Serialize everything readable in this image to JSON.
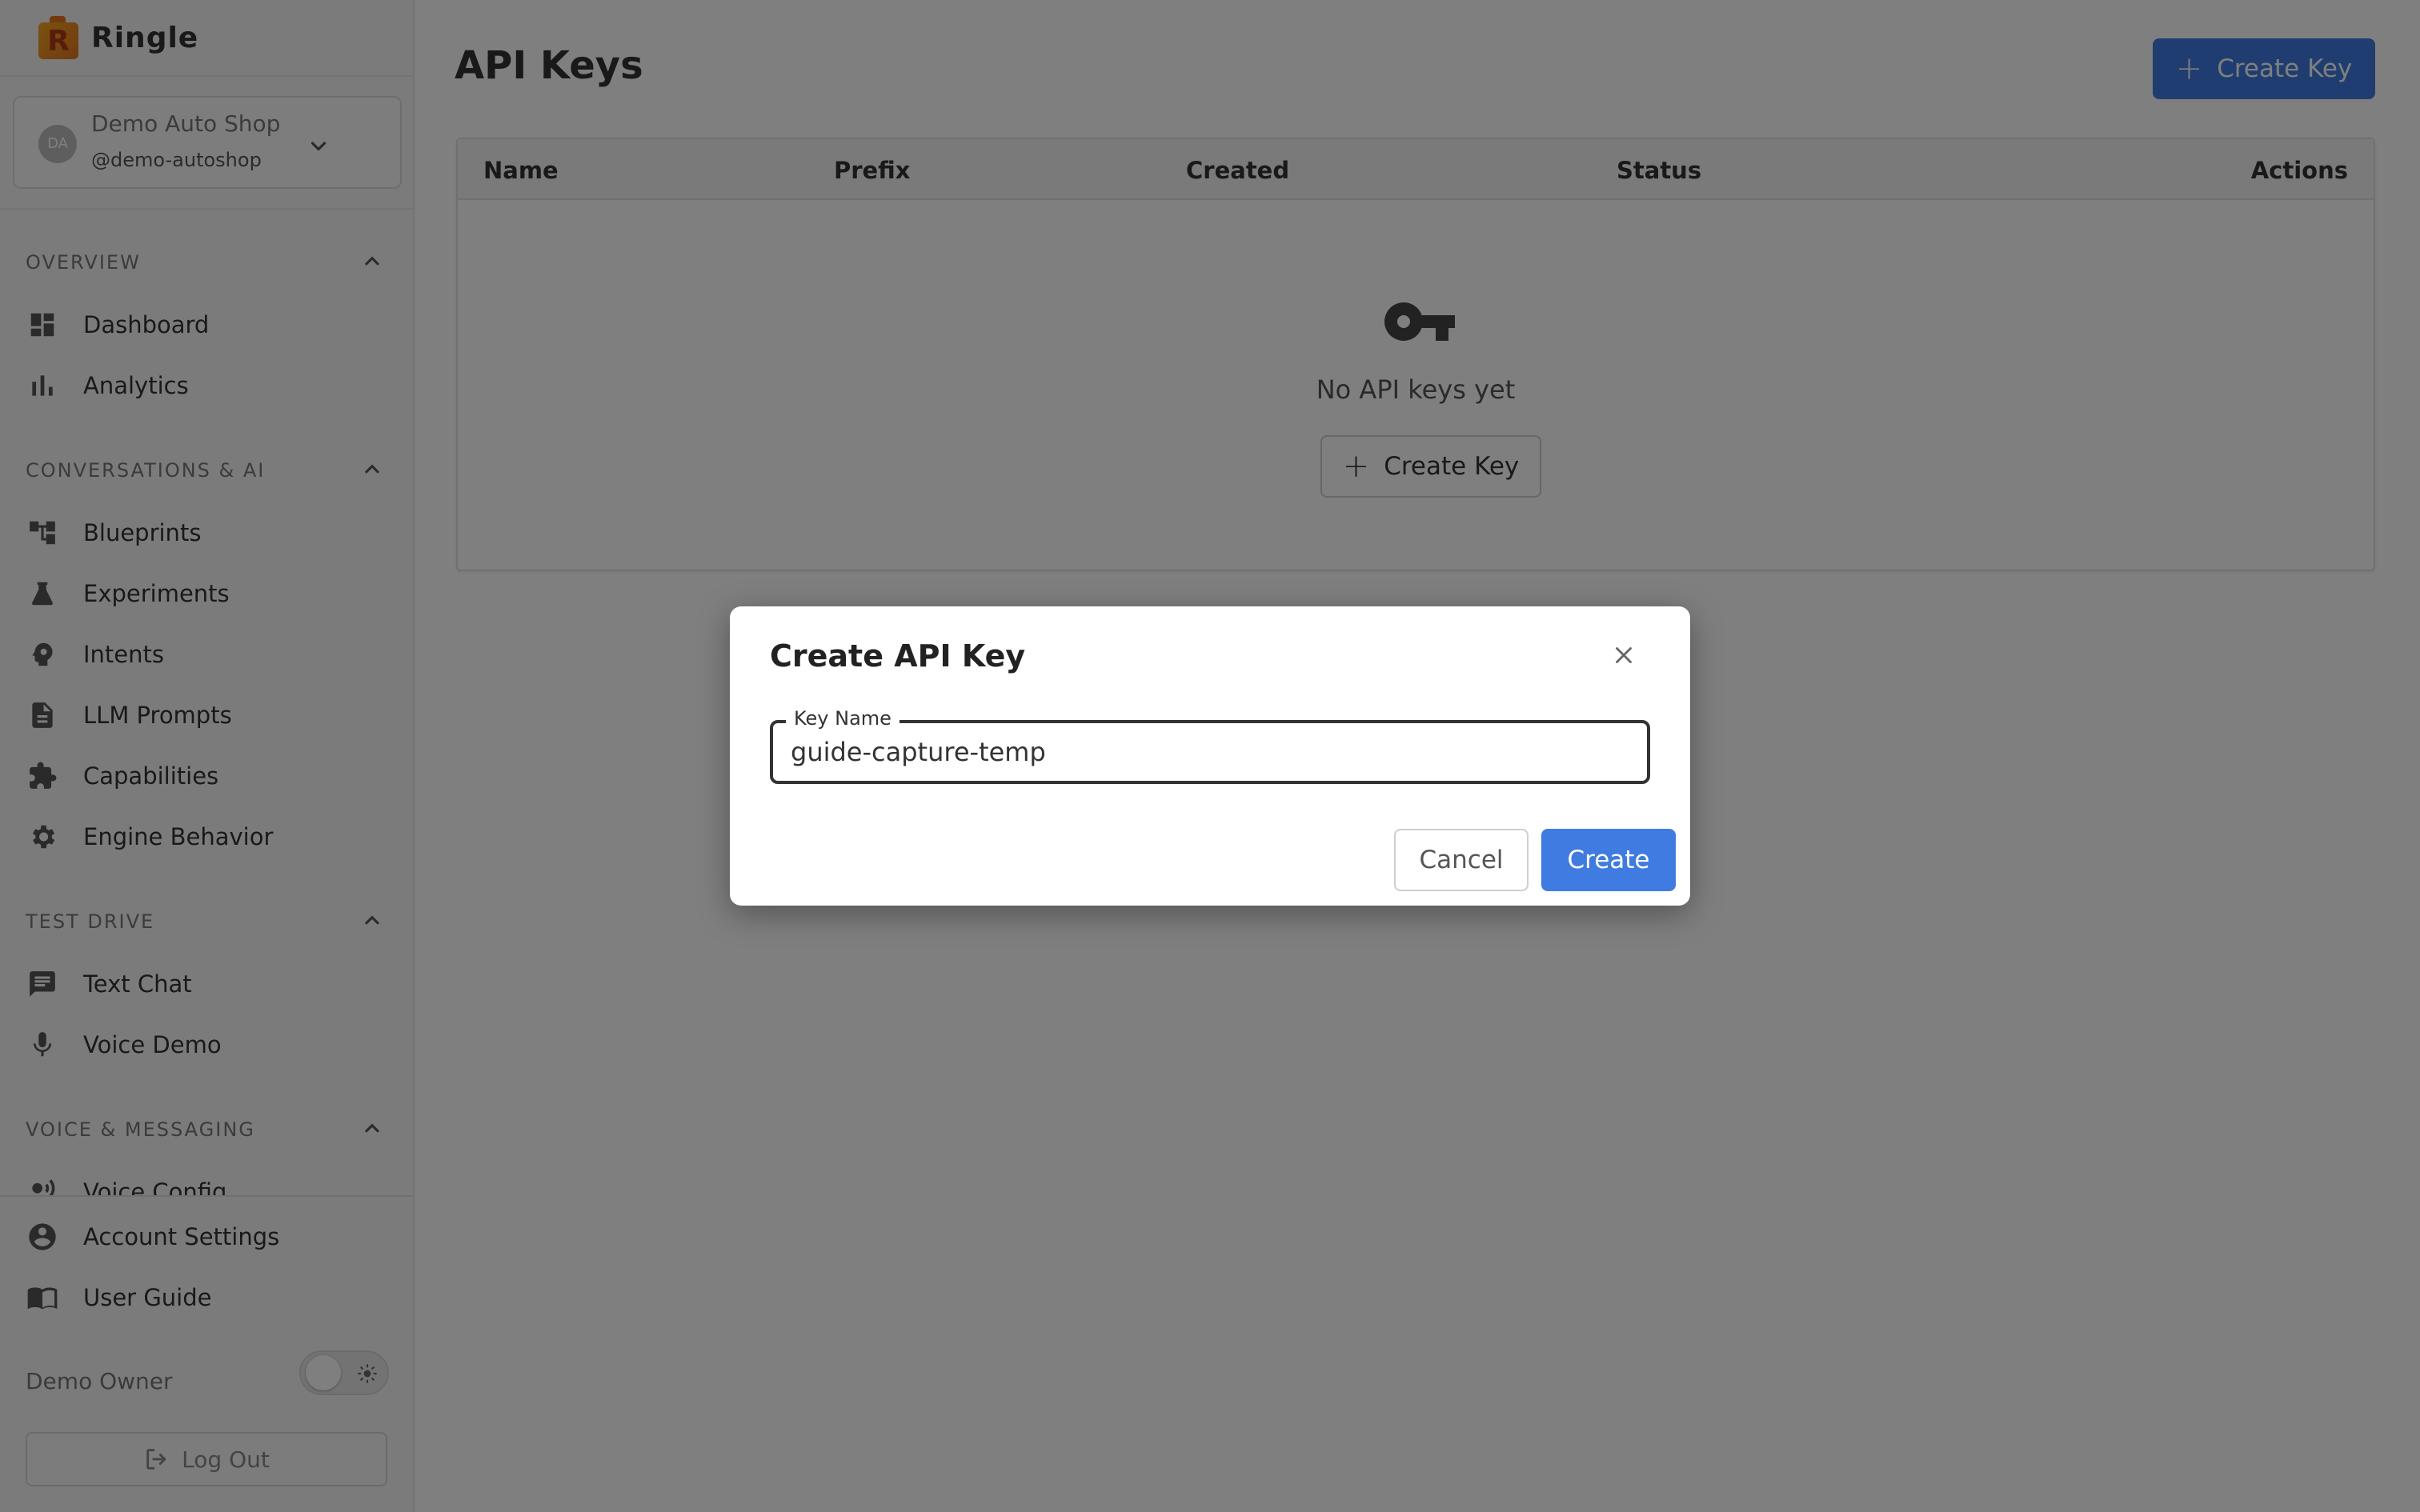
{
  "brand": {
    "name": "Ringle",
    "logo_letter": "R"
  },
  "org": {
    "avatar_initials": "DA",
    "name": "Demo Auto Shop",
    "handle": "@demo-autoshop"
  },
  "sidebar": {
    "sections": [
      {
        "title": "OVERVIEW",
        "items": [
          {
            "label": "Dashboard",
            "icon": "dashboard-icon"
          },
          {
            "label": "Analytics",
            "icon": "bar-chart-icon"
          }
        ]
      },
      {
        "title": "CONVERSATIONS & AI",
        "items": [
          {
            "label": "Blueprints",
            "icon": "account-tree-icon"
          },
          {
            "label": "Experiments",
            "icon": "flask-icon"
          },
          {
            "label": "Intents",
            "icon": "psychology-icon"
          },
          {
            "label": "LLM Prompts",
            "icon": "document-icon"
          },
          {
            "label": "Capabilities",
            "icon": "puzzle-icon"
          },
          {
            "label": "Engine Behavior",
            "icon": "gear-icon"
          }
        ]
      },
      {
        "title": "TEST DRIVE",
        "items": [
          {
            "label": "Text Chat",
            "icon": "chat-icon"
          },
          {
            "label": "Voice Demo",
            "icon": "microphone-icon"
          }
        ]
      },
      {
        "title": "VOICE & MESSAGING",
        "items": [
          {
            "label": "Voice Config",
            "icon": "voice-icon"
          }
        ]
      }
    ],
    "bottom": {
      "account_settings": "Account Settings",
      "user_guide": "User Guide",
      "owner_label": "Demo Owner",
      "logout": "Log Out"
    }
  },
  "main": {
    "title": "API Keys",
    "create_button": "Create Key",
    "table": {
      "columns": [
        "Name",
        "Prefix",
        "Created",
        "Status",
        "Actions"
      ],
      "rows": [],
      "empty_text": "No API keys yet",
      "empty_button": "Create Key"
    }
  },
  "modal": {
    "title": "Create API Key",
    "field_label": "Key Name",
    "field_value": "guide-capture-temp",
    "cancel": "Cancel",
    "create": "Create"
  },
  "colors": {
    "primary": "#3f7be0",
    "overlay": "rgba(0,0,0,0.5)",
    "brand_orange": "#e4741d"
  }
}
